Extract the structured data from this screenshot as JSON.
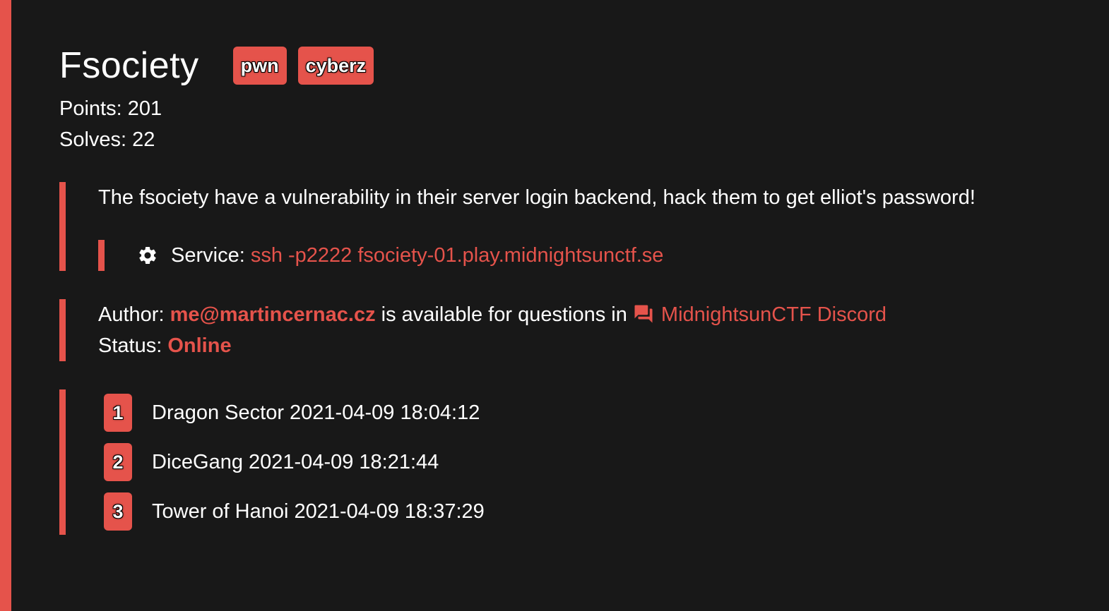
{
  "challenge": {
    "title": "Fsociety",
    "tags": [
      "pwn",
      "cyberz"
    ],
    "points_label": "Points: 201",
    "solves_label": "Solves: 22",
    "description": "The fsociety have a vulnerability in their server login backend, hack them to get elliot's password!",
    "service_label": "Service:",
    "service_value": "ssh -p2222 fsociety-01.play.midnightsunctf.se",
    "author_label": "Author:",
    "author_email": "me@martincernac.cz",
    "author_suffix": "is available for questions in",
    "discord_label": "MidnightsunCTF Discord",
    "status_label": "Status:",
    "status_value": "Online"
  },
  "solves": [
    {
      "rank": "1",
      "text": "Dragon Sector 2021-04-09 18:04:12"
    },
    {
      "rank": "2",
      "text": "DiceGang 2021-04-09 18:21:44"
    },
    {
      "rank": "3",
      "text": "Tower of Hanoi 2021-04-09 18:37:29"
    }
  ],
  "icons": {
    "service": "gear-icon",
    "discord": "chat-bubbles-icon"
  },
  "colors": {
    "accent": "#e5534b",
    "background": "#181818",
    "text": "#ffffff"
  }
}
